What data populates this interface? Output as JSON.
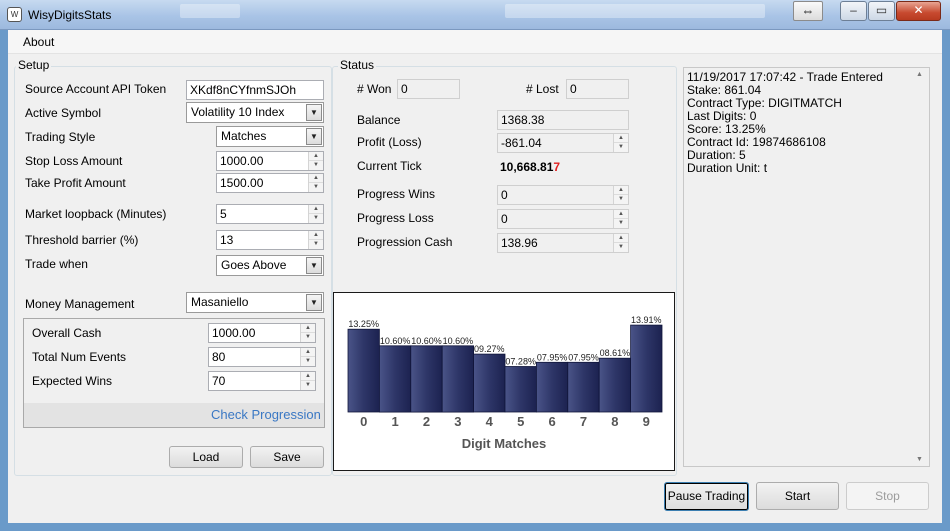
{
  "window": {
    "title": "WisyDigitsStats",
    "app_icon_text": "W"
  },
  "menu": {
    "about": "About"
  },
  "setup": {
    "title": "Setup",
    "api_token_label": "Source Account API Token",
    "api_token_value": "XKdf8nCYfnmSJOh",
    "active_symbol_label": "Active Symbol",
    "active_symbol_value": "Volatility 10 Index",
    "trading_style_label": "Trading Style",
    "trading_style_value": "Matches",
    "stop_loss_label": "Stop Loss Amount",
    "stop_loss_value": "1000.00",
    "take_profit_label": "Take Profit Amount",
    "take_profit_value": "1500.00",
    "market_loopback_label": "Market loopback (Minutes)",
    "market_loopback_value": "5",
    "threshold_label": "Threshold barrier (%)",
    "threshold_value": "13",
    "trade_when_label": "Trade when",
    "trade_when_value": "Goes Above",
    "money_mgmt_label": "Money Management",
    "money_mgmt_value": "Masaniello",
    "overall_cash_label": "Overall Cash",
    "overall_cash_value": "1000.00",
    "total_events_label": "Total Num Events",
    "total_events_value": "80",
    "expected_wins_label": "Expected Wins",
    "expected_wins_value": "70",
    "check_progression": "Check Progression",
    "load_label": "Load",
    "save_label": "Save"
  },
  "status": {
    "title": "Status",
    "won_label": "# Won",
    "won_value": "0",
    "lost_label": "# Lost",
    "lost_value": "0",
    "balance_label": "Balance",
    "balance_value": "1368.38",
    "profit_label": "Profit (Loss)",
    "profit_value": "-861.04",
    "current_tick_label": "Current Tick",
    "current_tick_main": "10,668.81",
    "current_tick_last": "7",
    "progress_wins_label": "Progress Wins",
    "progress_wins_value": "0",
    "progress_loss_label": "Progress Loss",
    "progress_loss_value": "0",
    "progression_cash_label": "Progression Cash",
    "progression_cash_value": "138.96"
  },
  "chart_data": {
    "type": "bar",
    "categories": [
      "0",
      "1",
      "2",
      "3",
      "4",
      "5",
      "6",
      "7",
      "8",
      "9"
    ],
    "values": [
      13.25,
      10.6,
      10.6,
      10.6,
      9.27,
      7.28,
      7.95,
      7.95,
      8.61,
      13.91
    ],
    "data_labels": [
      "13.25%",
      "10.60%",
      "10.60%",
      "10.60%",
      "09.27%",
      "07.28%",
      "07.95%",
      "07.95%",
      "08.61%",
      "13.91%"
    ],
    "title": "",
    "xlabel": "Digit Matches",
    "ylabel": "",
    "ylim": [
      0,
      16
    ],
    "grid": false,
    "bar_color": "#2a3260"
  },
  "log": {
    "lines": [
      "11/19/2017 17:07:42 - Trade Entered",
      "Stake: 861.04",
      "Contract Type: DIGITMATCH",
      "Last Digits: 0",
      "Score: 13.25%",
      "Contract Id: 19874686108",
      "Duration: 5",
      "Duration Unit: t"
    ]
  },
  "actions": {
    "pause_label": "Pause Trading",
    "start_label": "Start",
    "stop_label": "Stop"
  },
  "icons": {
    "minimize": "–",
    "maximize": "▭",
    "close": "✕",
    "swap": "⇔",
    "dropdown": "▼",
    "spin_up": "▲",
    "spin_down": "▼",
    "scroll_up": "▲",
    "scroll_down": "▼"
  }
}
